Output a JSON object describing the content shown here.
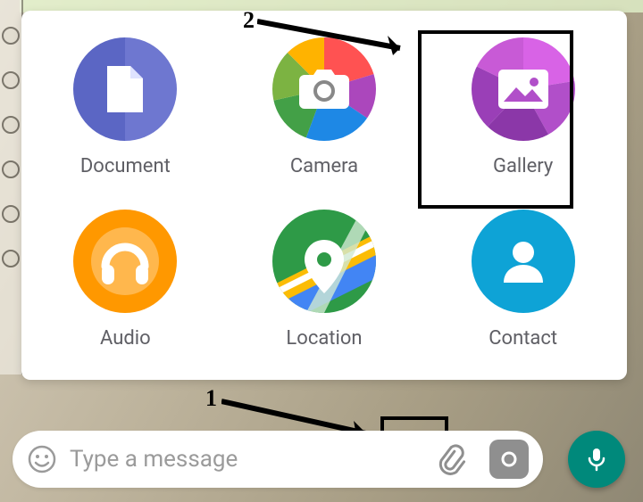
{
  "annotations": {
    "step1": "1",
    "step2": "2"
  },
  "attach": {
    "document": "Document",
    "camera": "Camera",
    "gallery": "Gallery",
    "audio": "Audio",
    "location": "Location",
    "contact": "Contact"
  },
  "input": {
    "placeholder": "Type a message"
  },
  "colors": {
    "doc_a": "#5b66c4",
    "doc_b": "#6e77d0",
    "cam_segments": [
      "#ff5252",
      "#ffb300",
      "#43a047",
      "#1e88e5",
      "#ab47bc",
      "#7cb342"
    ],
    "gal_a": "#c85ad6",
    "gal_b": "#9a3fb7",
    "gal_c": "#7b2f94",
    "aud_a": "#ff9800",
    "aud_b": "#ffb74d",
    "loc_a": "#2e9a47",
    "loc_b": "#4285f4",
    "loc_c": "#fbbc05",
    "con": "#0ea3d6",
    "fab": "#00897b"
  }
}
